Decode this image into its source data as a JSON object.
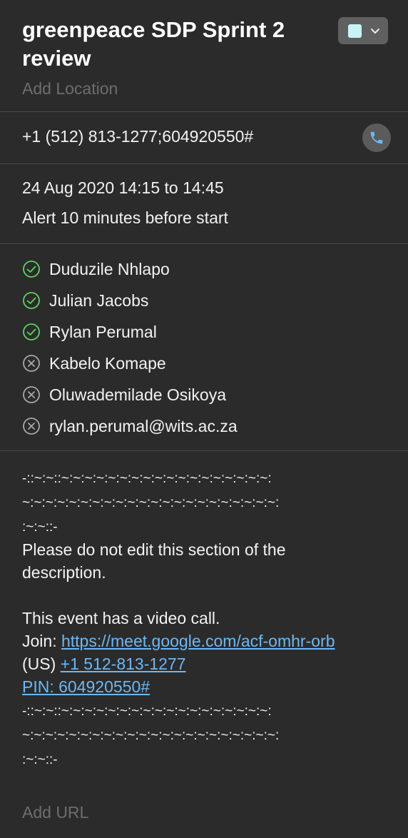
{
  "event": {
    "title": "greenpeace SDP Sprint 2 review",
    "location_placeholder": "Add Location",
    "calendar_color": "#c8f4f6"
  },
  "phone": {
    "number": "+1 (512) 813-1277;604920550#",
    "icon": "phone-icon"
  },
  "time": {
    "date_time": "24 Aug 2020  14:15 to 14:45",
    "alert": "Alert 10 minutes before start"
  },
  "attendees": [
    {
      "name": "Duduzile Nhlapo",
      "status": "accepted"
    },
    {
      "name": "Julian Jacobs",
      "status": "accepted"
    },
    {
      "name": "Rylan Perumal",
      "status": "accepted"
    },
    {
      "name": "Kabelo Komape",
      "status": "declined"
    },
    {
      "name": "Oluwademilade Osikoya",
      "status": "declined"
    },
    {
      "name": "rylan.perumal@wits.ac.za",
      "status": "declined"
    }
  ],
  "notes": {
    "separator_1a": "-::~:~::~:~:~:~:~:~:~:~:~:~:~:~:~:~:~:~:~:~:",
    "separator_1b": "~:~:~:~:~:~:~:~:~:~:~:~:~:~:~:~:~:~:~:~:~:~:",
    "separator_1c": ":~:~::-",
    "edit_warning": "Please do not edit this section of the description.",
    "video_call": "This event has a video call.",
    "join_label": "Join: ",
    "join_link": "https://meet.google.com/acf-omhr-orb",
    "us_label": "(US) ",
    "us_phone_link": "+1 512-813-1277",
    "pin_link": "PIN: 604920550#",
    "separator_2a": "-::~:~::~:~:~:~:~:~:~:~:~:~:~:~:~:~:~:~:~:~:",
    "separator_2b": "~:~:~:~:~:~:~:~:~:~:~:~:~:~:~:~:~:~:~:~:~:~:",
    "separator_2c": ":~:~::-"
  },
  "url_placeholder": "Add URL",
  "colors": {
    "accepted": "#5fd35f",
    "declined": "#a8a8a8",
    "link": "#6cb8f5",
    "phone_icon": "#6cb8f5"
  }
}
